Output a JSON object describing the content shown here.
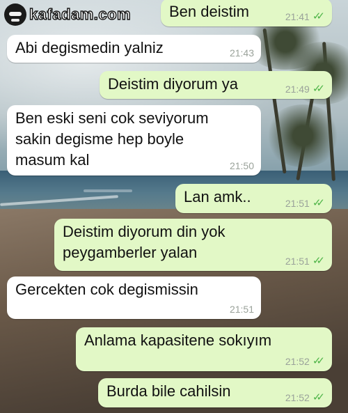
{
  "watermark": {
    "logo_text": "kafadam.com",
    "icon": "face-icon"
  },
  "messages": [
    {
      "dir": "out",
      "text": "Ben deistim",
      "time": "21:41",
      "status": "read"
    },
    {
      "dir": "in",
      "text": "Abi degismedin yalniz",
      "time": "21:43"
    },
    {
      "dir": "out",
      "text": "Deistim diyorum ya",
      "time": "21:49",
      "status": "read"
    },
    {
      "dir": "in",
      "text": "Ben eski seni cok seviyorum\nsakin degisme hep boyle\nmasum kal",
      "time": "21:50"
    },
    {
      "dir": "out",
      "text": "Lan amk..",
      "time": "21:51",
      "status": "read"
    },
    {
      "dir": "out",
      "text": "Deistim diyorum din yok\npeygamberler yalan",
      "time": "21:51",
      "status": "read"
    },
    {
      "dir": "in",
      "text": "Gercekten cok degismissin",
      "time": "21:51"
    },
    {
      "dir": "out",
      "text": "Anlama kapasitene sokıyım",
      "time": "21:52",
      "status": "read"
    },
    {
      "dir": "out",
      "text": "Burda bile cahilsin",
      "time": "21:52",
      "status": "read"
    }
  ],
  "colors": {
    "incoming": "#ffffff",
    "outgoing": "#e2f8c6",
    "tick": "#4fb548",
    "timestamp": "#9aa29a"
  },
  "tick_glyph": "✓✓"
}
